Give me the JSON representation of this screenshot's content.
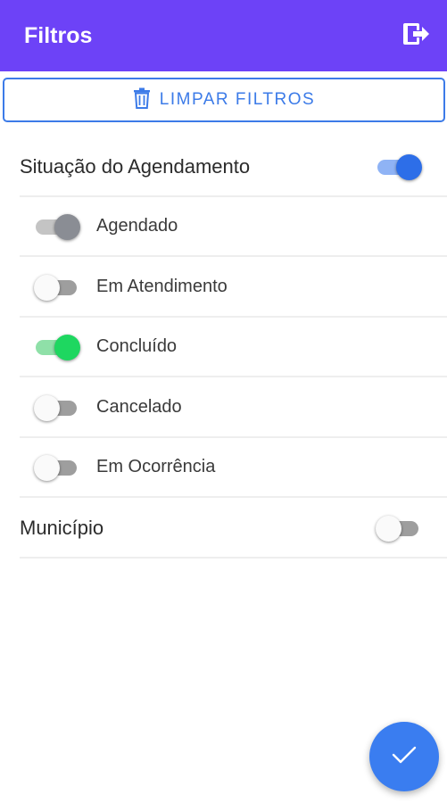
{
  "header": {
    "title": "Filtros",
    "exit_icon": "logout-icon"
  },
  "clear_button": {
    "label": "LIMPAR FILTROS",
    "icon": "trash-icon",
    "color": "#3c7be8"
  },
  "sections": {
    "situacao": {
      "label": "Situação do Agendamento",
      "enabled": true,
      "options": [
        {
          "label": "Agendado",
          "checked": true,
          "state": "disabled-on"
        },
        {
          "label": "Em Atendimento",
          "checked": false
        },
        {
          "label": "Concluído",
          "checked": true
        },
        {
          "label": "Cancelado",
          "checked": false
        },
        {
          "label": "Em Ocorrência",
          "checked": false
        }
      ]
    },
    "municipio": {
      "label": "Município",
      "enabled": false
    }
  },
  "fab": {
    "icon": "check-icon"
  },
  "colors": {
    "header": "#6d42f7",
    "accent": "#3a7df0",
    "success": "#1ed760"
  }
}
